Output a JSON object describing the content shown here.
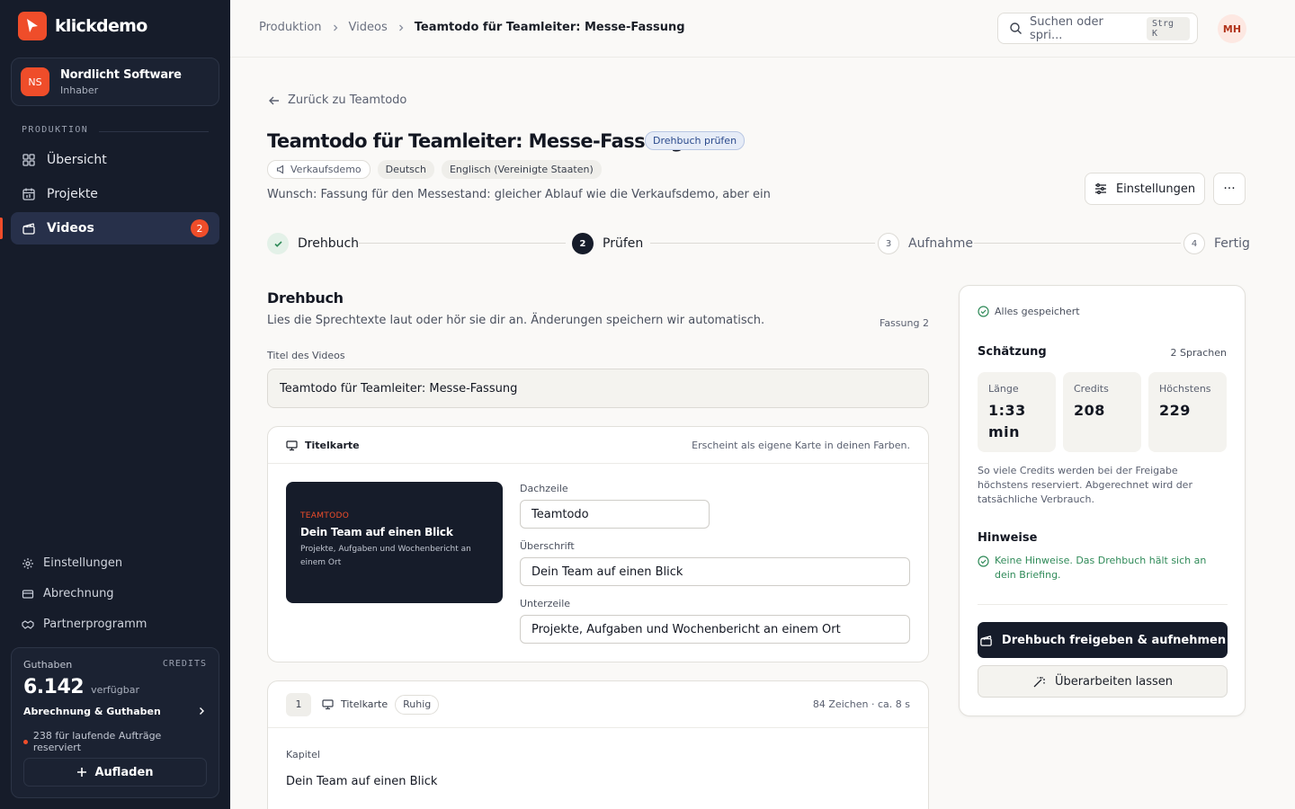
{
  "app": {
    "name": "klickdemo"
  },
  "org": {
    "initials": "NS",
    "name": "Nordlicht Software",
    "role": "Inhaber"
  },
  "sidebar": {
    "section_label": "PRODUKTION",
    "items": [
      {
        "label": "Übersicht",
        "icon": "grid-icon"
      },
      {
        "label": "Projekte",
        "icon": "calendar-icon"
      },
      {
        "label": "Videos",
        "icon": "clapper-icon",
        "badge": "2",
        "active": true
      }
    ],
    "bottom_items": [
      {
        "label": "Einstellungen",
        "icon": "gear-icon"
      },
      {
        "label": "Abrechnung",
        "icon": "wallet-icon"
      },
      {
        "label": "Partnerprogramm",
        "icon": "handshake-icon"
      }
    ]
  },
  "credits": {
    "label": "Guthaben",
    "tag": "CREDITS",
    "amount": "6.142",
    "amount_suffix": "verfügbar",
    "link": "Abrechnung & Guthaben",
    "reserved": "238 für laufende Aufträge reserviert",
    "topup": "Aufladen"
  },
  "topbar": {
    "breadcrumbs": [
      "Produktion",
      "Videos",
      "Teamtodo für Teamleiter: Messe-Fassung"
    ],
    "search_placeholder": "Suchen oder spri...",
    "search_shortcut": "Strg K",
    "user_initials": "MH"
  },
  "page": {
    "back": "Zurück zu Teamtodo",
    "title": "Teamtodo für Teamleiter: Messe-Fassung",
    "status": "Drehbuch prüfen",
    "tags": [
      "Verkaufsdemo",
      "Deutsch",
      "Englisch (Vereinigte Staaten)"
    ],
    "wish": "Wunsch: Fassung für den Messestand: gleicher Ablauf wie die Verkaufsdemo, aber ein...",
    "settings_button": "Einstellungen",
    "more_button": "···"
  },
  "steps": [
    {
      "num": "",
      "label": "Drehbuch",
      "state": "done"
    },
    {
      "num": "2",
      "label": "Prüfen",
      "state": "current"
    },
    {
      "num": "3",
      "label": "Aufnahme",
      "state": "todo"
    },
    {
      "num": "4",
      "label": "Fertig",
      "state": "todo"
    }
  ],
  "script": {
    "heading": "Drehbuch",
    "subtitle": "Lies die Sprechtexte laut oder hör sie dir an. Änderungen speichern wir automatisch.",
    "version": "Fassung 2",
    "title_label": "Titel des Videos",
    "title_value": "Teamtodo für Teamleiter: Messe-Fassung",
    "title_card": {
      "header": "Titelkarte",
      "header_note": "Erscheint als eigene Karte in deinen Farben.",
      "kicker_label": "Dachzeile",
      "kicker": "Teamtodo",
      "kicker_preview": "TEAMTODO",
      "headline_label": "Überschrift",
      "headline": "Dein Team auf einen Blick",
      "subline_label": "Unterzeile",
      "subline": "Projekte, Aufgaben und Wochenbericht an einem Ort"
    },
    "scene": {
      "number": "1",
      "type": "Titelkarte",
      "mood": "Ruhig",
      "stats": "84 Zeichen · ca. 8 s",
      "chapter_label": "Kapitel",
      "chapter_text": "Dein Team auf einen Blick"
    }
  },
  "panel": {
    "saved": "Alles gespeichert",
    "estimate_title": "Schätzung",
    "estimate_langs": "2 Sprachen",
    "metrics": [
      {
        "label": "Länge",
        "value": "1:33 min"
      },
      {
        "label": "Credits",
        "value": "208"
      },
      {
        "label": "Höchstens",
        "value": "229"
      }
    ],
    "note": "So viele Credits werden bei der Freigabe höchstens reserviert. Abgerechnet wird der tatsächliche Verbrauch.",
    "hints_title": "Hinweise",
    "hint": "Keine Hinweise. Das Drehbuch hält sich an dein Briefing.",
    "primary_button": "Drehbuch freigeben & aufnehmen",
    "secondary_button": "Überarbeiten lassen"
  },
  "colors": {
    "accent": "#ef4d2a",
    "sidebar": "#161c2a",
    "success": "#2f8a58"
  }
}
